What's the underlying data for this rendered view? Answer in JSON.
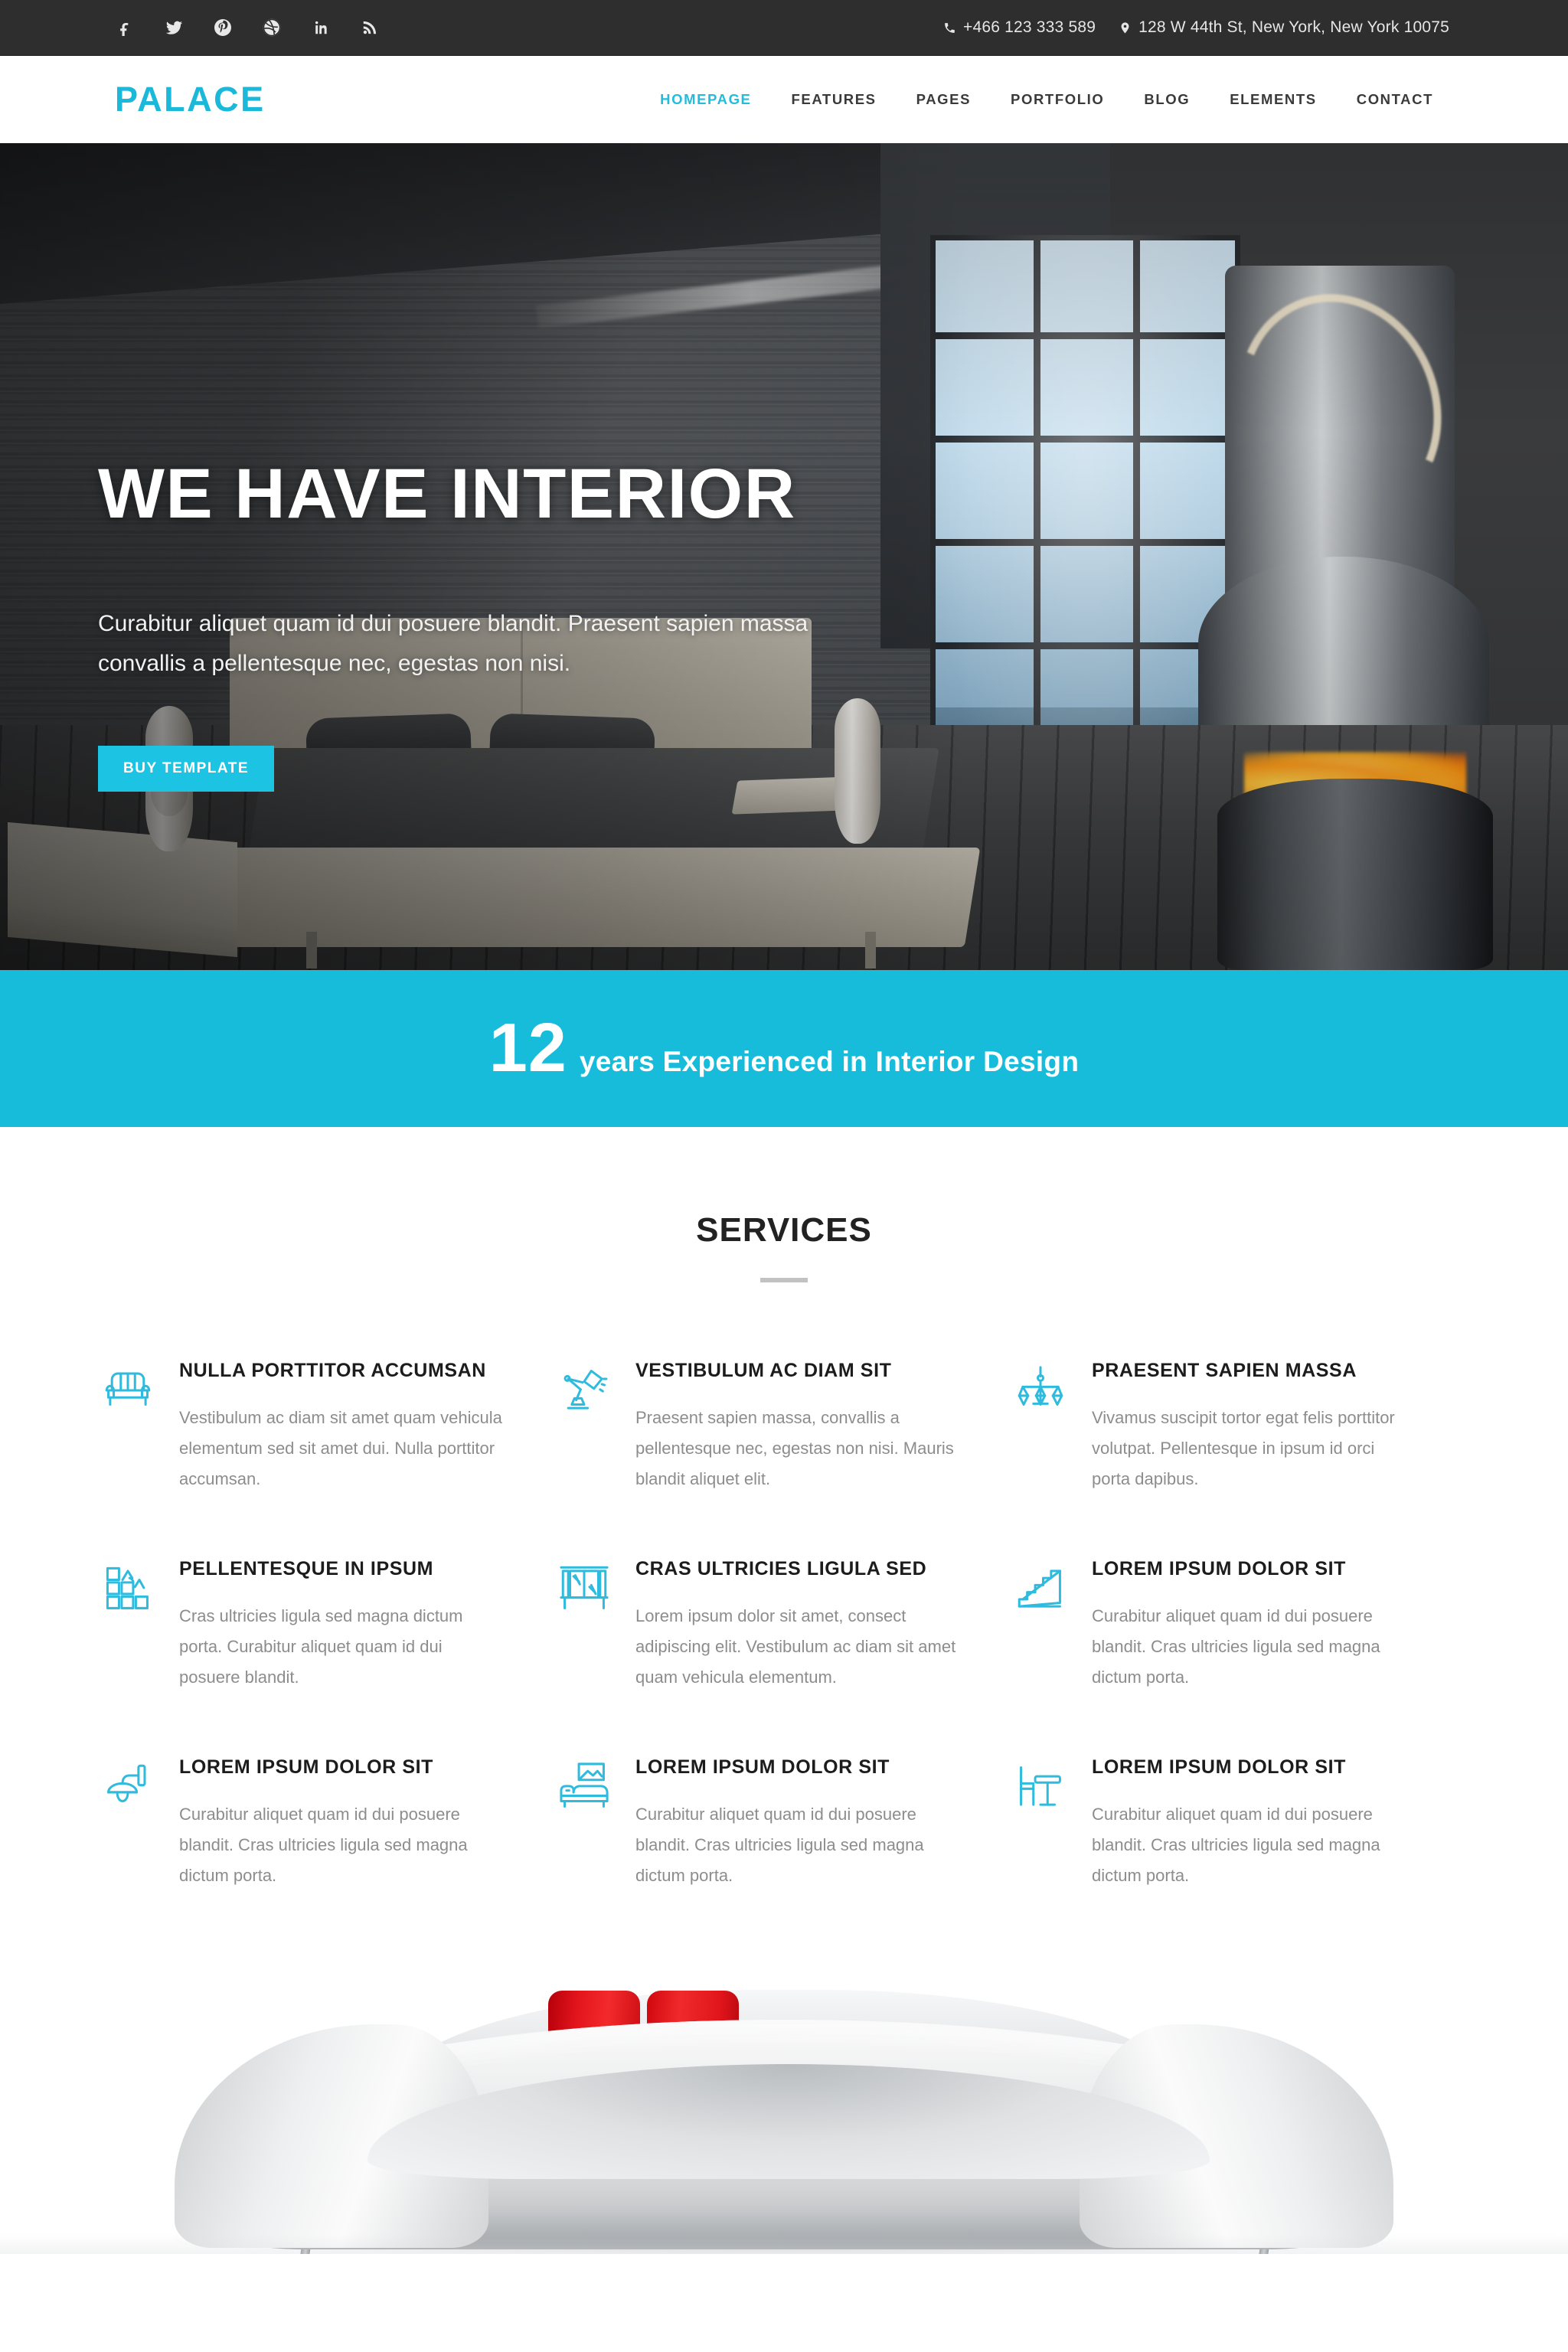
{
  "topbar": {
    "social": [
      {
        "name": "facebook-icon",
        "label": "Facebook"
      },
      {
        "name": "twitter-icon",
        "label": "Twitter"
      },
      {
        "name": "pinterest-icon",
        "label": "Pinterest"
      },
      {
        "name": "dribbble-icon",
        "label": "Dribbble"
      },
      {
        "name": "linkedin-icon",
        "label": "LinkedIn"
      },
      {
        "name": "rss-icon",
        "label": "RSS"
      }
    ],
    "phone": "+466 123 333 589",
    "address": "128 W 44th St, New York, New York 10075"
  },
  "header": {
    "logo": "PALACE",
    "nav": [
      {
        "label": "HOMEPAGE",
        "active": true
      },
      {
        "label": "FEATURES",
        "active": false
      },
      {
        "label": "PAGES",
        "active": false
      },
      {
        "label": "PORTFOLIO",
        "active": false
      },
      {
        "label": "BLOG",
        "active": false
      },
      {
        "label": "ELEMENTS",
        "active": false
      },
      {
        "label": "CONTACT",
        "active": false
      }
    ]
  },
  "hero": {
    "title": "WE HAVE INTERIOR",
    "subtitle": "Curabitur aliquet quam id dui posuere blandit. Praesent sapien massa convallis a pellentesque nec, egestas non nisi.",
    "button": "BUY TEMPLATE"
  },
  "stats": {
    "number": "12",
    "text": "years Experienced in Interior Design"
  },
  "services": {
    "title": "SERVICES",
    "items": [
      {
        "icon": "armchair-icon",
        "title": "NULLA PORTTITOR ACCUMSAN",
        "text": "Vestibulum ac diam sit amet quam vehicula elementum sed sit amet dui. Nulla porttitor accumsan."
      },
      {
        "icon": "desk-lamp-icon",
        "title": "VESTIBULUM AC DIAM SIT",
        "text": "Praesent sapien massa, convallis a pellentesque nec, egestas non nisi. Mauris blandit aliquet elit."
      },
      {
        "icon": "chandelier-icon",
        "title": "PRAESENT SAPIEN MASSA",
        "text": "Vivamus suscipit tortor egat felis porttitor volutpat. Pellentesque in ipsum id orci porta dapibus."
      },
      {
        "icon": "tiles-icon",
        "title": "PELLENTESQUE IN IPSUM",
        "text": "Cras ultricies ligula sed magna dictum porta. Curabitur aliquet quam id dui posuere blandit."
      },
      {
        "icon": "window-icon",
        "title": "CRAS ULTRICIES LIGULA SED",
        "text": "Lorem ipsum dolor sit amet, consect adipiscing elit. Vestibulum ac diam sit amet quam vehicula elementum."
      },
      {
        "icon": "stairs-icon",
        "title": "LOREM IPSUM DOLOR SIT",
        "text": "Curabitur aliquet quam id dui posuere blandit. Cras ultricies ligula sed magna dictum porta."
      },
      {
        "icon": "wall-lamp-icon",
        "title": "LOREM IPSUM DOLOR SIT",
        "text": "Curabitur aliquet quam id dui posuere blandit. Cras ultricies ligula sed magna dictum porta."
      },
      {
        "icon": "sofa-picture-icon",
        "title": "LOREM IPSUM DOLOR SIT",
        "text": "Curabitur aliquet quam id dui posuere blandit. Cras ultricies ligula sed magna dictum porta."
      },
      {
        "icon": "table-chair-icon",
        "title": "LOREM IPSUM DOLOR SIT",
        "text": "Curabitur aliquet quam id dui posuere blandit. Cras ultricies ligula sed magna dictum porta."
      }
    ]
  },
  "colors": {
    "accent": "#1bb8d9",
    "accent_band": "#17bcdb",
    "accent_button": "#1cc3e3",
    "topbar_bg": "#2e2e2e",
    "service_icon": "#2fbbdd",
    "body_text": "#8d8d8d",
    "heading": "#1c1c1c",
    "cushion_red": "#e2141c"
  }
}
